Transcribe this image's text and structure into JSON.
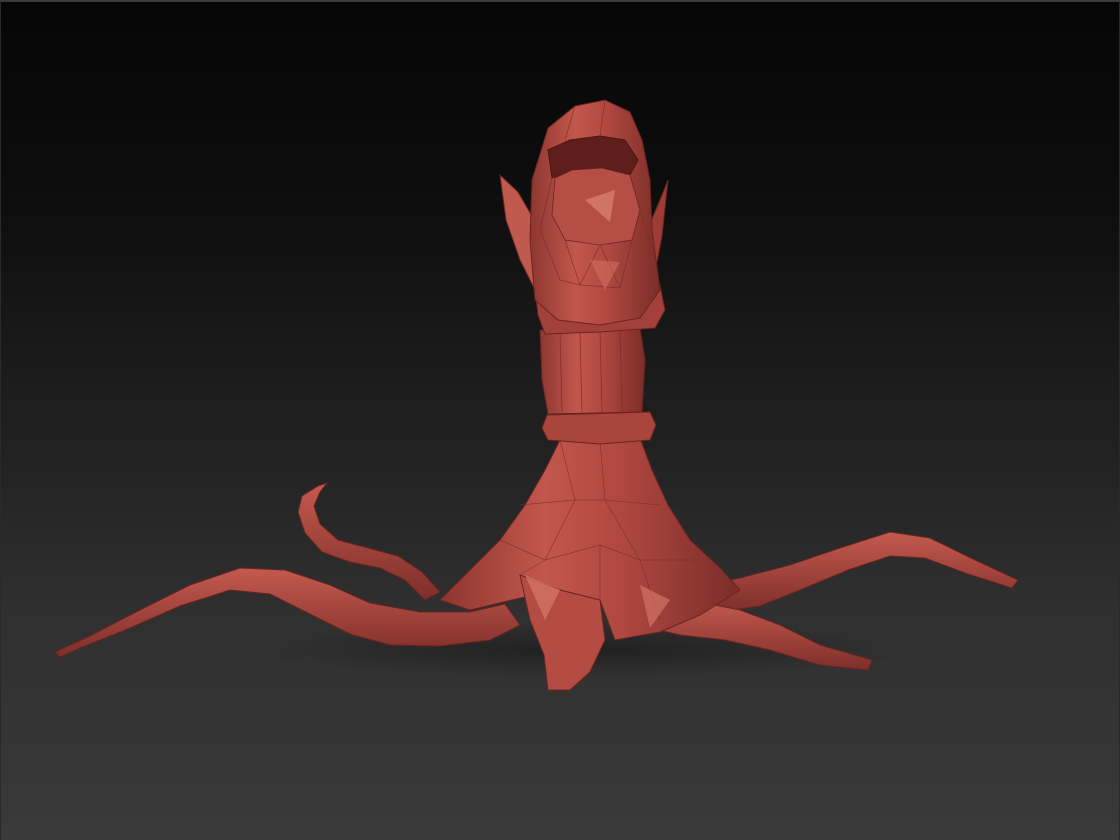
{
  "viewport": {
    "background_top": "#060606",
    "background_bottom": "#3a3a3a"
  },
  "model": {
    "subject": "low-poly sculpt",
    "material_color": "#b24a42",
    "material_highlight": "#d9796c",
    "material_shadow": "#6e2622",
    "wireframe_color": "#8c3a34"
  }
}
